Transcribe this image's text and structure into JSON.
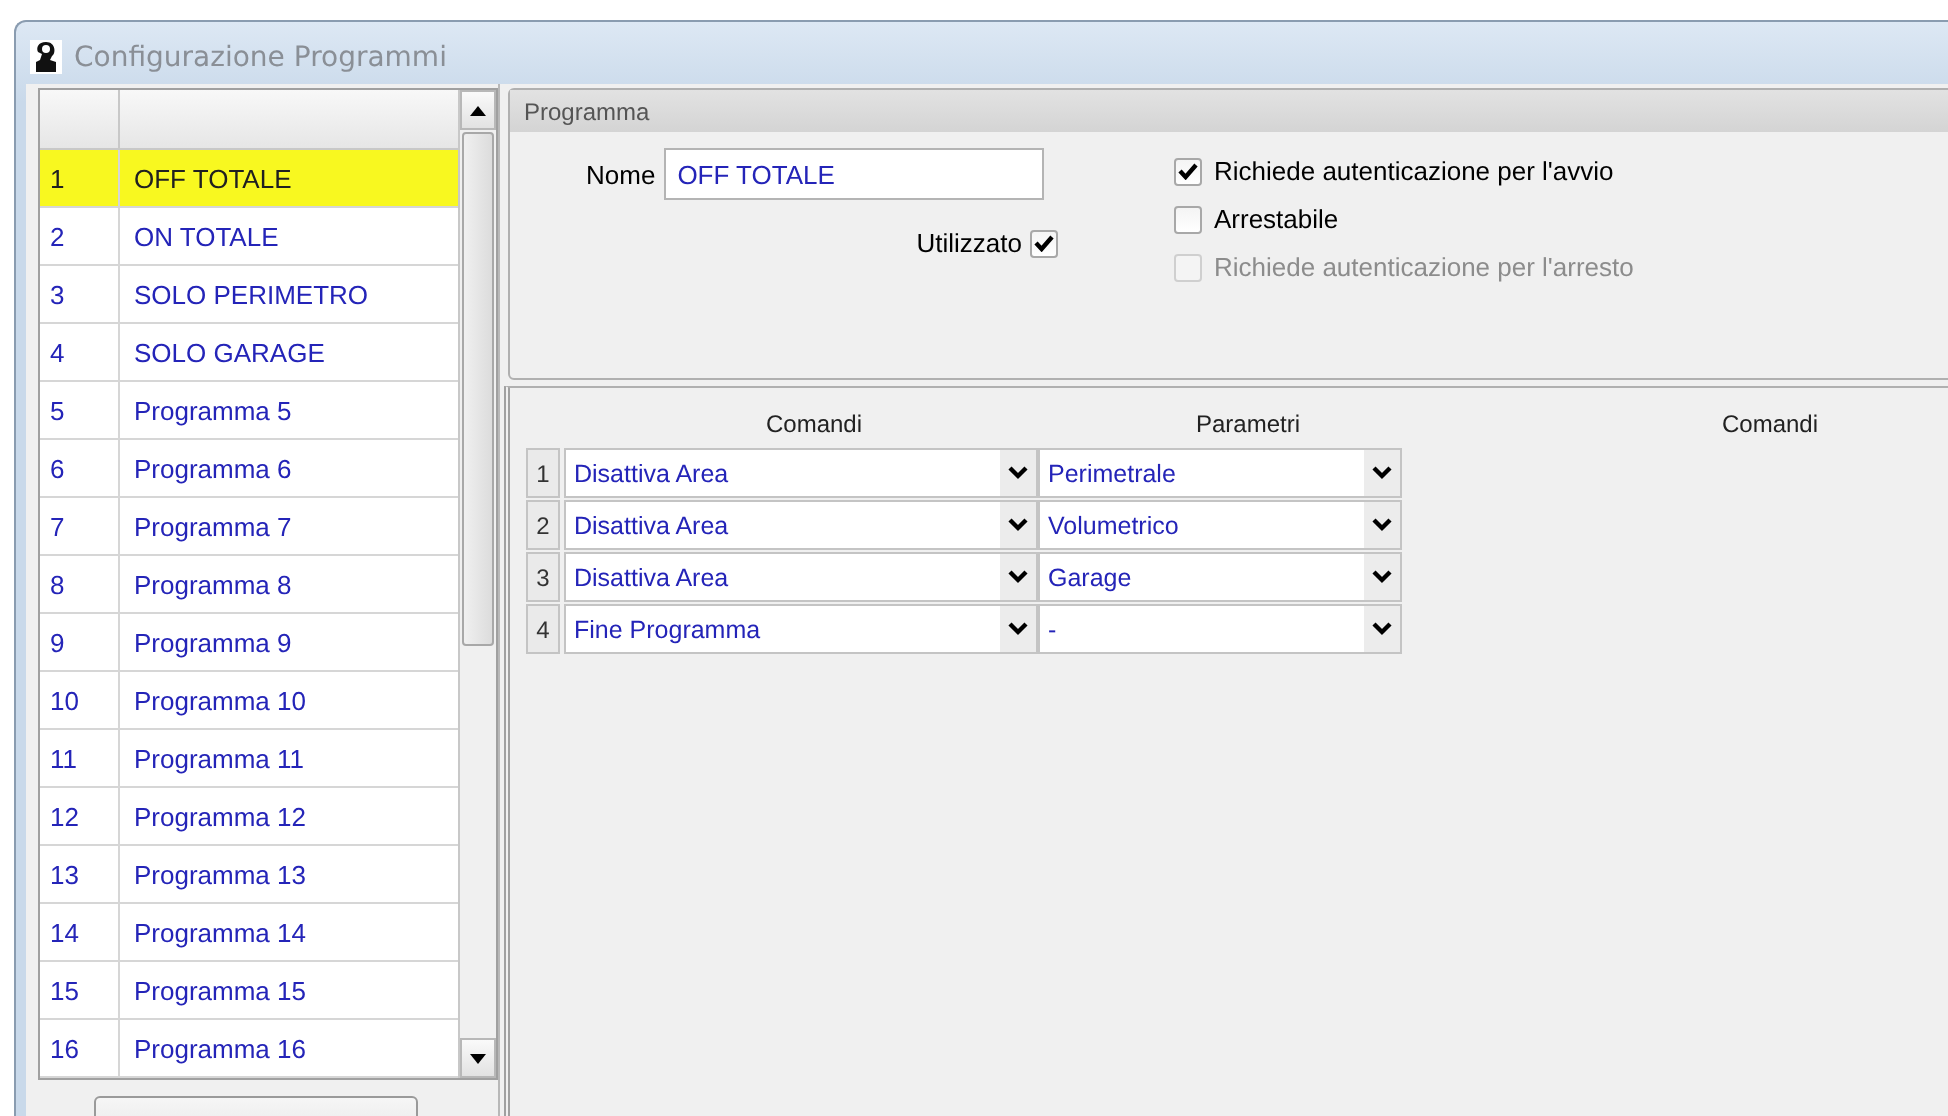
{
  "window": {
    "title": "Configurazione Programmi"
  },
  "programs": [
    {
      "number": "1",
      "name": "OFF TOTALE",
      "selected": true
    },
    {
      "number": "2",
      "name": "ON TOTALE",
      "selected": false
    },
    {
      "number": "3",
      "name": "SOLO PERIMETRO",
      "selected": false
    },
    {
      "number": "4",
      "name": "SOLO GARAGE",
      "selected": false
    },
    {
      "number": "5",
      "name": "Programma 5",
      "selected": false
    },
    {
      "number": "6",
      "name": "Programma 6",
      "selected": false
    },
    {
      "number": "7",
      "name": "Programma 7",
      "selected": false
    },
    {
      "number": "8",
      "name": "Programma 8",
      "selected": false
    },
    {
      "number": "9",
      "name": "Programma 9",
      "selected": false
    },
    {
      "number": "10",
      "name": "Programma 10",
      "selected": false
    },
    {
      "number": "11",
      "name": "Programma 11",
      "selected": false
    },
    {
      "number": "12",
      "name": "Programma 12",
      "selected": false
    },
    {
      "number": "13",
      "name": "Programma 13",
      "selected": false
    },
    {
      "number": "14",
      "name": "Programma 14",
      "selected": false
    },
    {
      "number": "15",
      "name": "Programma 15",
      "selected": false
    },
    {
      "number": "16",
      "name": "Programma 16",
      "selected": false
    }
  ],
  "programma": {
    "title": "Programma",
    "name_label": "Nome",
    "name_value": "OFF TOTALE",
    "used": {
      "label": "Utilizzato",
      "checked": true
    },
    "options": [
      {
        "label": "Richiede autenticazione per l'avvio",
        "checked": true,
        "disabled": false
      },
      {
        "label": "Arrestabile",
        "checked": false,
        "disabled": false
      },
      {
        "label": "Richiede autenticazione per l'arresto",
        "checked": false,
        "disabled": true
      }
    ]
  },
  "commands": {
    "columns": [
      "Comandi",
      "Parametri",
      "Comandi"
    ],
    "rows": [
      {
        "number": "1",
        "command": "Disattiva Area",
        "parameter": "Perimetrale"
      },
      {
        "number": "2",
        "command": "Disattiva Area",
        "parameter": "Volumetrico"
      },
      {
        "number": "3",
        "command": "Disattiva Area",
        "parameter": "Garage"
      },
      {
        "number": "4",
        "command": "Fine Programma",
        "parameter": "-"
      }
    ]
  }
}
